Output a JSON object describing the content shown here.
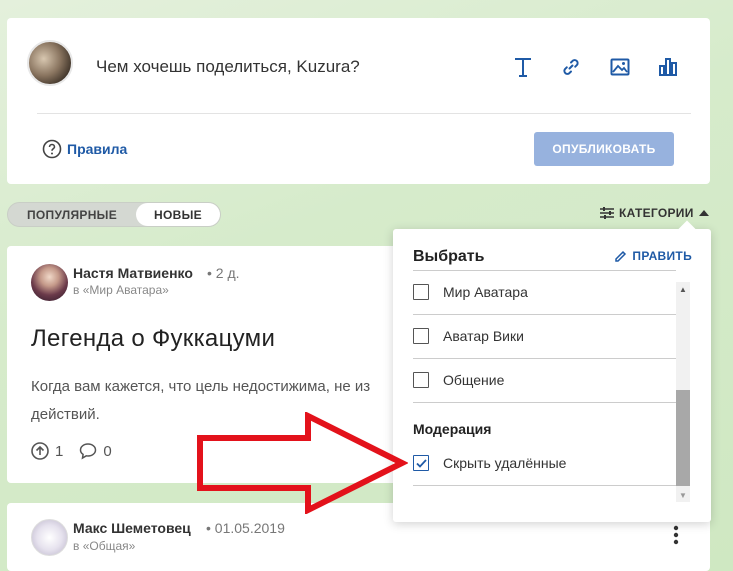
{
  "composer": {
    "prompt": "Чем хочешь поделиться, Kuzura?",
    "tools": [
      "text-icon",
      "link-icon",
      "image-icon",
      "poll-icon"
    ],
    "rules_label": "Правила",
    "publish_label": "ОПУБЛИКОВАТЬ"
  },
  "feed": {
    "sort_popular": "ПОПУЛЯРНЫЕ",
    "sort_new": "НОВЫЕ",
    "active_sort": "НОВЫЕ",
    "categories_label": "КАТЕГОРИИ"
  },
  "posts": [
    {
      "author": "Настя Матвиенко",
      "time": "2 д.",
      "category": "в «Мир Аватара»",
      "title": "Легенда о Фуккацуми",
      "excerpt": "Когда вам кажется, что цель недостижима, не из\nдействий.",
      "upvotes": "1",
      "comments": "0"
    },
    {
      "author": "Макс Шеметовец",
      "time": "01.05.2019",
      "category": "в «Общая»"
    }
  ],
  "category_dropdown": {
    "title": "Выбрать",
    "edit_label": "ПРАВИТЬ",
    "items": [
      {
        "label": "Мир Аватара",
        "checked": false
      },
      {
        "label": "Аватар Вики",
        "checked": false
      },
      {
        "label": "Общение",
        "checked": false
      }
    ],
    "moderation_title": "Модерация",
    "moderation_items": [
      {
        "label": "Скрыть удалённые",
        "checked": true
      }
    ]
  },
  "colors": {
    "accent": "#1f5aa6",
    "publish_disabled": "#97b2de",
    "annotation_arrow": "#e3121b",
    "background": "#d6ebcb"
  }
}
